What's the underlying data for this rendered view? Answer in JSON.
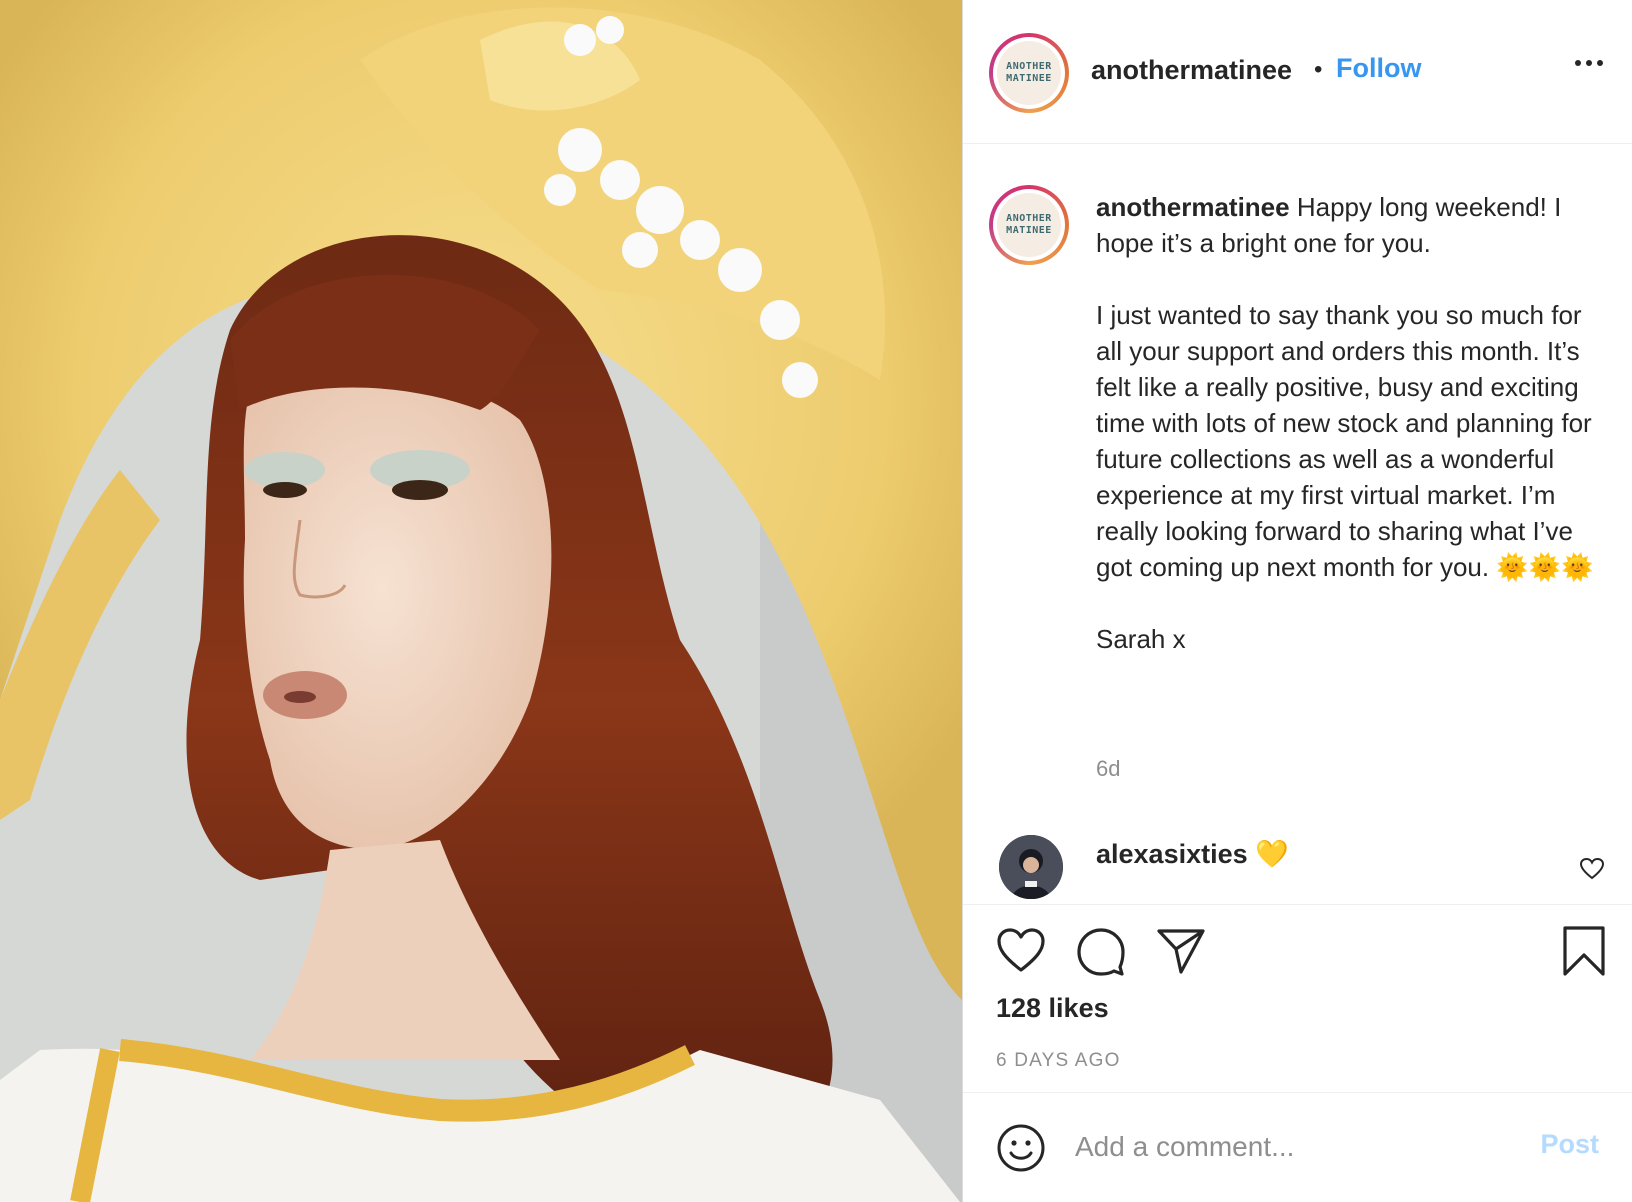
{
  "post": {
    "username": "anothermatinee",
    "follow_label": "Follow",
    "separator": "•",
    "logo_line1": "ANOTHER",
    "logo_line2": "MATINEE",
    "caption_lead": "Happy long weekend! I hope it’s a bright one for you.",
    "caption_body": "I just wanted to say thank you so much for all your support and orders this month. It’s felt like a really positive, busy and exciting time with lots of new stock and planning for future collections as well as a wonderful experience at my first virtual market. I’m really looking forward to sharing what I’ve got coming up next month for you. 🌞🌞🌞",
    "signoff": "Sarah x",
    "timestamp_short": "6d",
    "likes": "128 likes",
    "timestamp_long": "6 DAYS AGO"
  },
  "comment": {
    "username": "alexasixties",
    "text": "💛"
  },
  "comment_bar": {
    "placeholder": "Add a comment...",
    "post_label": "Post"
  },
  "icons": {
    "like": "heart-icon",
    "comment": "speech-bubble-icon",
    "share": "paper-plane-icon",
    "save": "bookmark-icon",
    "emoji": "smiley-icon",
    "more": "ellipsis-icon"
  },
  "colors": {
    "follow": "#3797f0",
    "post_disabled": "#b3dbff",
    "muted": "#8e8e8e",
    "text": "#262626"
  }
}
